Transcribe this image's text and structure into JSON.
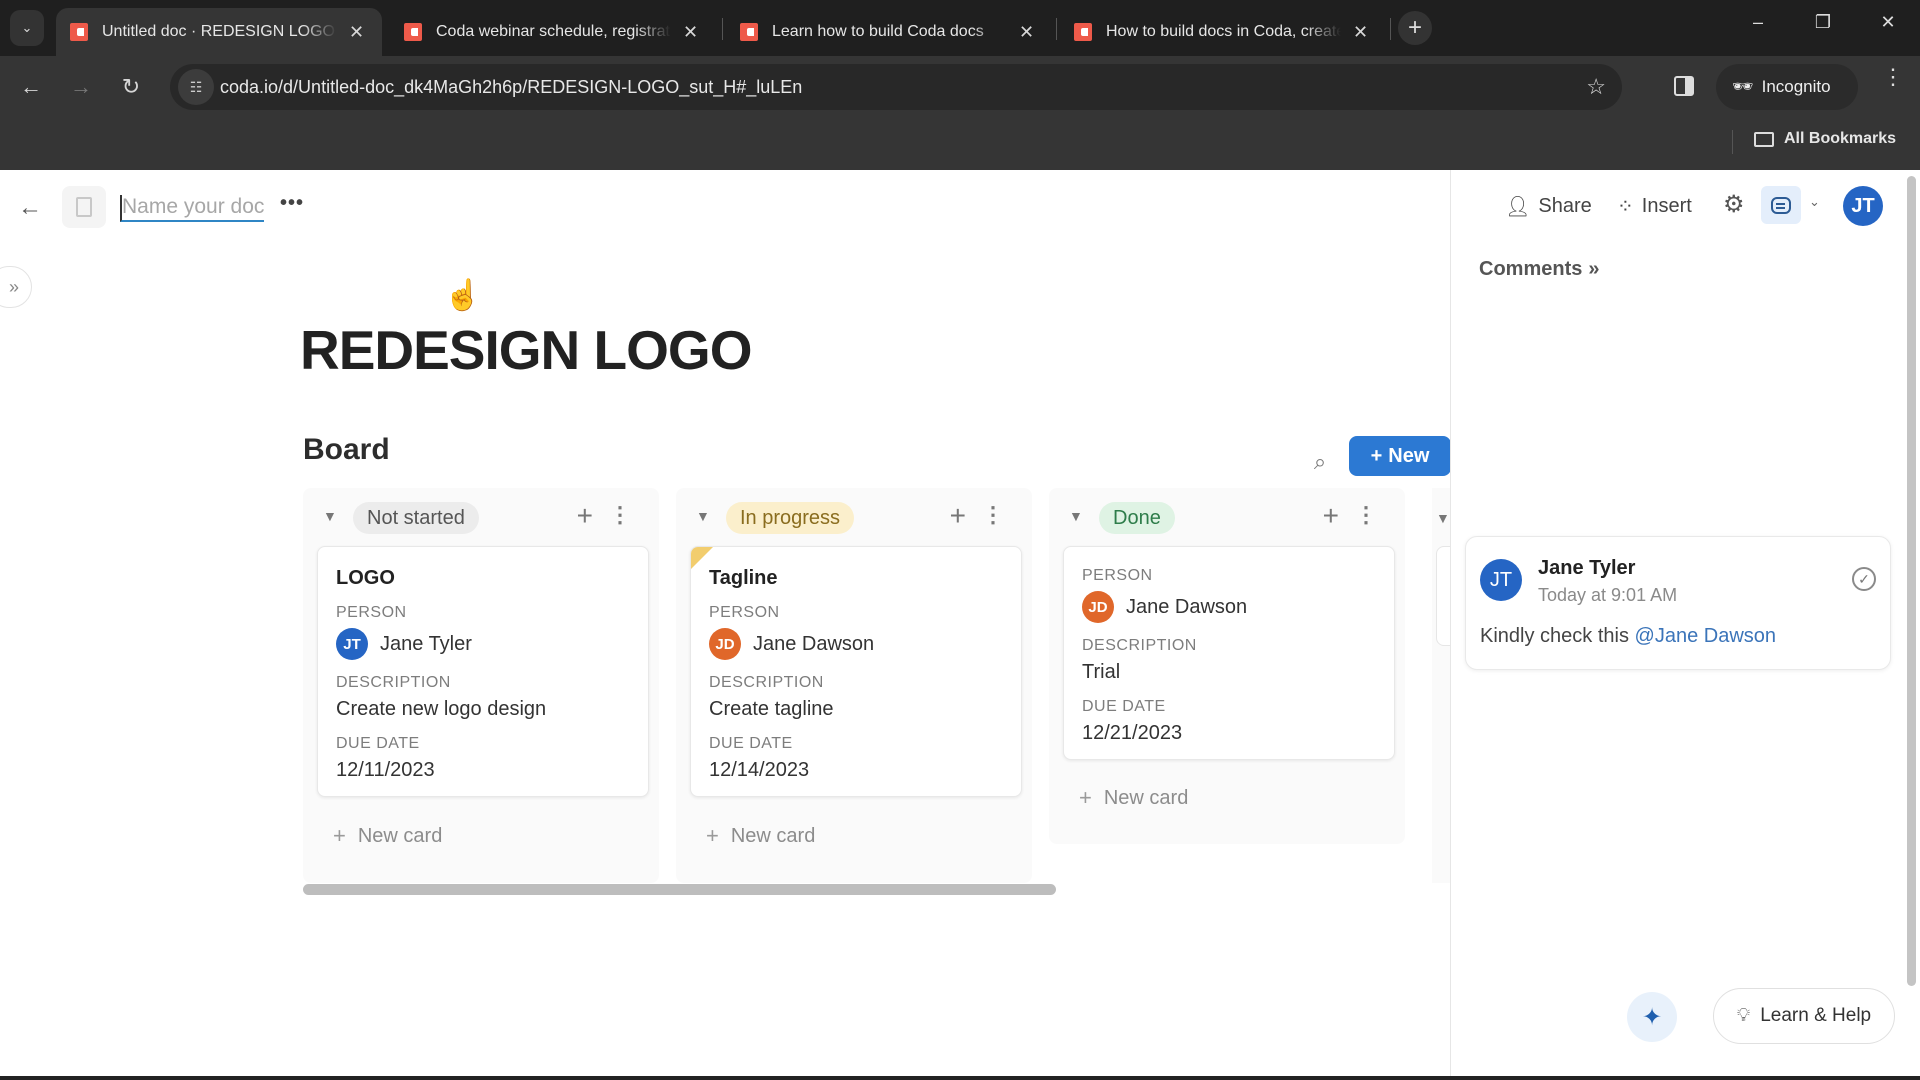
{
  "browser": {
    "tabs": [
      {
        "title": "Untitled doc · REDESIGN LOGO",
        "active": true
      },
      {
        "title": "Coda webinar schedule, registration",
        "active": false
      },
      {
        "title": "Learn how to build Coda docs",
        "active": false
      },
      {
        "title": "How to build docs in Coda, create",
        "active": false
      }
    ],
    "new_tab": "+",
    "url": "coda.io/d/Untitled-doc_dk4MaGh2h6p/REDESIGN-LOGO_sut_H#_luLEn",
    "incognito_label": "Incognito",
    "all_bookmarks_label": "All Bookmarks"
  },
  "doc": {
    "name_placeholder": "Name your doc",
    "more_label": "•••",
    "page_title": "REDESIGN LOGO"
  },
  "board": {
    "title": "Board",
    "new_button_label": "New",
    "new_card_label": "New card",
    "columns": [
      {
        "status": "Not started",
        "status_bg": "#ececec",
        "status_color": "#555555",
        "cards": [
          {
            "title": "LOGO",
            "person_label": "PERSON",
            "person": "Jane Tyler",
            "person_initials": "JT",
            "person_color": "#2565c4",
            "description_label": "DESCRIPTION",
            "description": "Create new logo design",
            "due_label": "DUE DATE",
            "due": "12/11/2023"
          }
        ]
      },
      {
        "status": "In progress",
        "status_bg": "#fbefcc",
        "status_color": "#8a6d1f",
        "cards": [
          {
            "title": "Tagline",
            "person_label": "PERSON",
            "person": "Jane Dawson",
            "person_initials": "JD",
            "person_color": "#e0672a",
            "description_label": "DESCRIPTION",
            "description": "Create tagline",
            "due_label": "DUE DATE",
            "due": "12/14/2023"
          }
        ]
      },
      {
        "status": "Done",
        "status_bg": "#dff3e4",
        "status_color": "#2e7d4a",
        "cards": [
          {
            "title": "",
            "person_label": "PERSON",
            "person": "Jane Dawson",
            "person_initials": "JD",
            "person_color": "#e0672a",
            "description_label": "DESCRIPTION",
            "description": "Trial",
            "due_label": "DUE DATE",
            "due": "12/21/2023"
          }
        ]
      }
    ]
  },
  "right_panel": {
    "share_label": "Share",
    "insert_label": "Insert",
    "user_initials": "JT",
    "comments_title": "Comments",
    "comment": {
      "author": "Jane Tyler",
      "author_initials": "JT",
      "time": "Today at 9:01 AM",
      "body": "Kindly check this",
      "mention": "@Jane Dawson"
    },
    "learn_help_label": "Learn & Help"
  }
}
